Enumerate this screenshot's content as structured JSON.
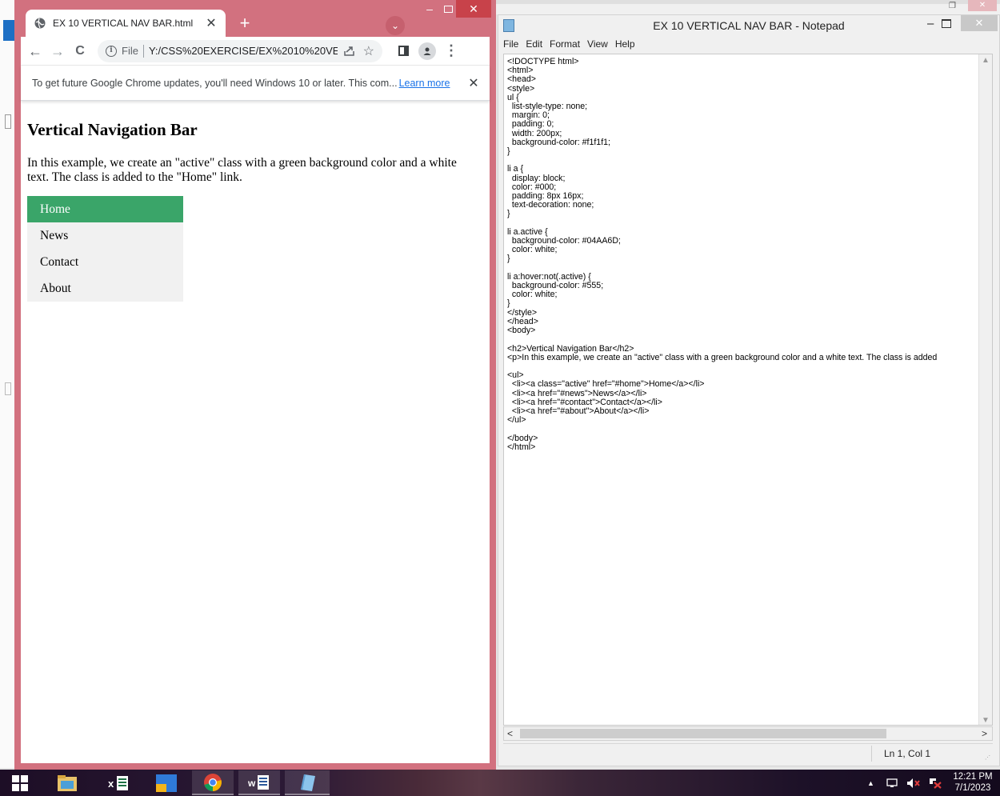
{
  "chrome": {
    "tab_title": "EX 10 VERTICAL NAV BAR.html",
    "tab_close": "✕",
    "new_tab": "+",
    "tab_search": "⌄",
    "window_controls": {
      "minimize": "–",
      "close": "✕"
    },
    "nav": {
      "back": "←",
      "forward": "→",
      "reload": "C"
    },
    "omnibox": {
      "info": "i",
      "scheme_label": "File",
      "url": "Y:/CSS%20EXERCISE/EX%2010%20VE..."
    },
    "star": "☆",
    "menu": "⋮",
    "notice": {
      "text": "To get future Google Chrome updates, you'll need Windows 10 or later. This com...",
      "link": "Learn more",
      "close": "✕"
    }
  },
  "page": {
    "heading": "Vertical Navigation Bar",
    "paragraph": "In this example, we create an \"active\" class with a green background color and a white text. The class is added to the \"Home\" link.",
    "nav_items": [
      "Home",
      "News",
      "Contact",
      "About"
    ],
    "active_color": "#3aa569"
  },
  "notepad": {
    "title": "EX 10 VERTICAL NAV BAR - Notepad",
    "controls": {
      "minimize": "–",
      "close": "✕"
    },
    "menu": [
      "File",
      "Edit",
      "Format",
      "View",
      "Help"
    ],
    "code": "<!DOCTYPE html>\n<html>\n<head>\n<style>\nul {\n  list-style-type: none;\n  margin: 0;\n  padding: 0;\n  width: 200px;\n  background-color: #f1f1f1;\n}\n\nli a {\n  display: block;\n  color: #000;\n  padding: 8px 16px;\n  text-decoration: none;\n}\n\nli a.active {\n  background-color: #04AA6D;\n  color: white;\n}\n\nli a:hover:not(.active) {\n  background-color: #555;\n  color: white;\n}\n</style>\n</head>\n<body>\n\n<h2>Vertical Navigation Bar</h2>\n<p>In this example, we create an \"active\" class with a green background color and a white text. The class is added\n\n<ul>\n  <li><a class=\"active\" href=\"#home\">Home</a></li>\n  <li><a href=\"#news\">News</a></li>\n  <li><a href=\"#contact\">Contact</a></li>\n  <li><a href=\"#about\">About</a></li>\n</ul>\n\n</body>\n</html>",
    "scroll": {
      "up": "▲",
      "down": "▼",
      "left": "<",
      "right": ">"
    },
    "status_position": "Ln 1, Col 1"
  },
  "taskbar": {
    "icons": [
      "windows-start-icon",
      "file-explorer-icon",
      "excel-icon",
      "blue-app-icon",
      "chrome-icon",
      "word-icon",
      "notepad-icon"
    ],
    "tray": {
      "overflow": "▲"
    },
    "clock": {
      "time": "12:21 PM",
      "date": "7/1/2023"
    }
  }
}
